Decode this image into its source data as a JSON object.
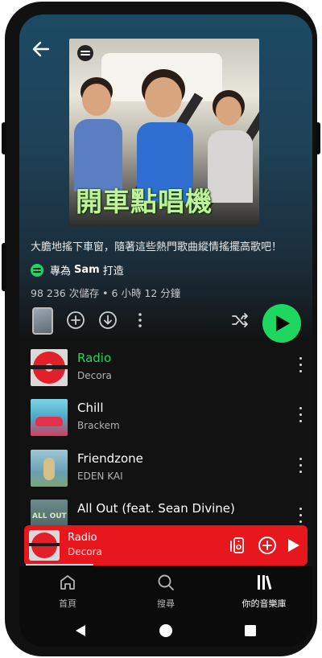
{
  "playlist": {
    "cover_title": "開車點唱機",
    "description": "大膽地搖下車窗，隨著這些熱門歌曲縱情搖擺高歌吧！",
    "made_for_prefix": "專為",
    "made_for_user": "Sam",
    "made_for_suffix": "打造",
    "stats": "98 236 次儲存 • 6 小時 12 分鐘"
  },
  "tracks": [
    {
      "title": "Radio",
      "artist": "Decora",
      "playing": true
    },
    {
      "title": "Chill",
      "artist": "Brackem",
      "playing": false
    },
    {
      "title": "Friendzone",
      "artist": "EDEN KAI",
      "playing": false
    },
    {
      "title": "All Out (feat. Sean Divine)",
      "artist": "",
      "playing": false
    }
  ],
  "track_art_text": {
    "allout": "ALL OUT"
  },
  "now_playing": {
    "title": "Radio",
    "artist": "Decora",
    "progress": 0.24
  },
  "nav": {
    "items": [
      {
        "label": "首頁",
        "icon": "home-icon",
        "active": false
      },
      {
        "label": "搜尋",
        "icon": "search-icon",
        "active": false
      },
      {
        "label": "你的音樂庫",
        "icon": "library-icon",
        "active": true
      }
    ]
  },
  "colors": {
    "accent_green": "#1ed760",
    "now_playing_bg": "#e8171d",
    "background": "#121212"
  }
}
